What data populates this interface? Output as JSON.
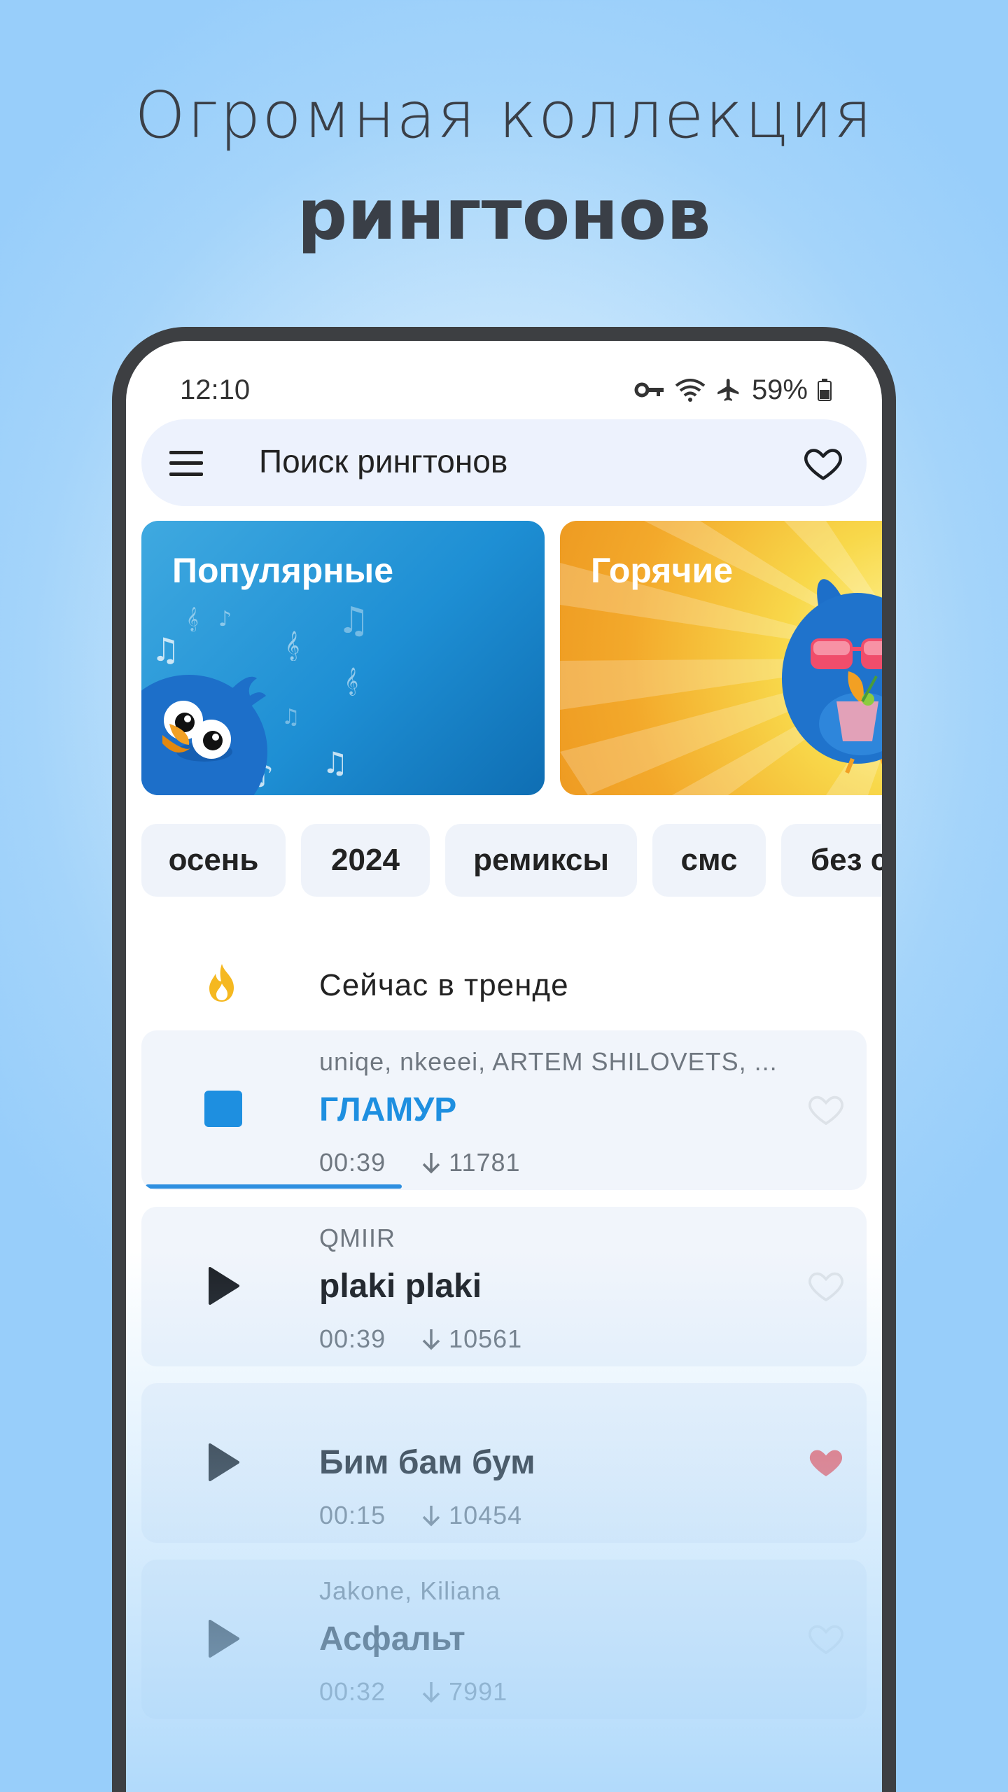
{
  "headline": {
    "line1": "Огромная коллекция",
    "line2": "рингтонов"
  },
  "status_bar": {
    "time": "12:10",
    "battery": "59%"
  },
  "search": {
    "placeholder": "Поиск рингтонов"
  },
  "categories": [
    {
      "label": "Популярные"
    },
    {
      "label": "Горячие"
    }
  ],
  "chips": [
    "осень",
    "2024",
    "ремиксы",
    "смс",
    "без сл"
  ],
  "trending": {
    "label": "Сейчас в тренде",
    "items": [
      {
        "artist": "uniqe, nkeeei, ARTEM SHILOVETS, ...",
        "title": "ГЛАМУР",
        "duration": "00:39",
        "downloads": "11781",
        "state": "playing",
        "favorite": false,
        "progress": 0.36
      },
      {
        "artist": "QMIIR",
        "title": "plaki plaki",
        "duration": "00:39",
        "downloads": "10561",
        "state": "stopped",
        "favorite": false
      },
      {
        "artist": "",
        "title": "Бим бам бум",
        "duration": "00:15",
        "downloads": "10454",
        "state": "stopped",
        "favorite": true
      },
      {
        "artist": "Jakone, Kiliana",
        "title": "Асфальт",
        "duration": "00:32",
        "downloads": "7991",
        "state": "stopped",
        "favorite": false
      }
    ]
  },
  "colors": {
    "accent": "#1e8fe0",
    "favorite": "#f26166",
    "trend_icon": "#f5b820"
  }
}
